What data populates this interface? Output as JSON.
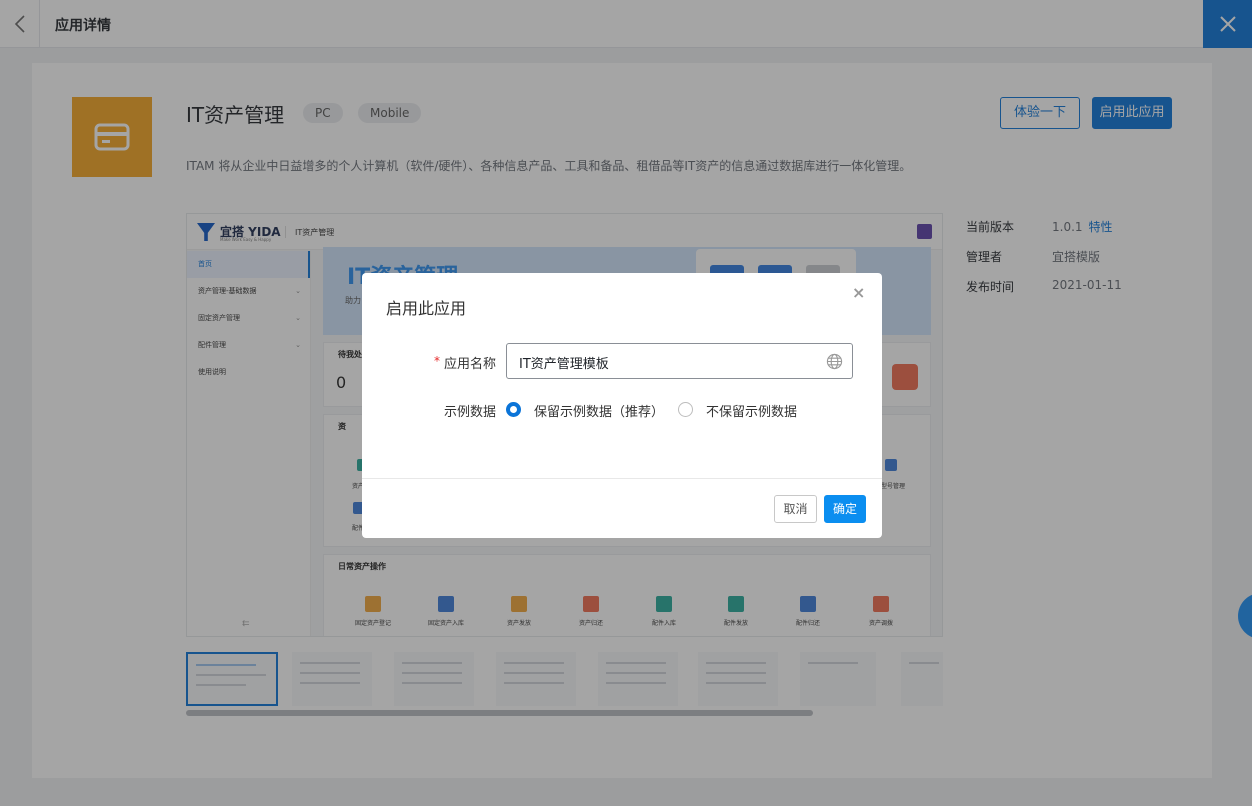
{
  "topbar": {
    "title": "应用详情"
  },
  "app": {
    "name": "IT资产管理",
    "tags": [
      "PC",
      "Mobile"
    ],
    "try_label": "体验一下",
    "enable_label": "启用此应用",
    "description": "ITAM 将从企业中日益增多的个人计算机（软件/硬件）、各种信息产品、工具和备品、租借品等IT资产的信息通过数据库进行一体化管理。"
  },
  "meta": {
    "version_label": "当前版本",
    "version_value": "1.0.1",
    "features_link": "特性",
    "admin_label": "管理者",
    "admin_value": "宜搭模版",
    "publish_label": "发布时间",
    "publish_value": "2021-01-11"
  },
  "preview": {
    "brand": "宜搭 YIDA",
    "brand_sub": "Make Work Easy & Happy",
    "app_title": "IT资产管理",
    "nav": [
      {
        "label": "首页",
        "active": true,
        "chevron": false
      },
      {
        "label": "资产管理-基础数据",
        "active": false,
        "chevron": true
      },
      {
        "label": "固定资产管理",
        "active": false,
        "chevron": true
      },
      {
        "label": "配件管理",
        "active": false,
        "chevron": true
      },
      {
        "label": "使用说明",
        "active": false,
        "chevron": false
      }
    ],
    "side_footer": "⇇",
    "banner_title": "IT资产管理",
    "banner_sub": "助力",
    "pending_title": "待我处理",
    "pending_count": "0",
    "section1_title": "资",
    "tile_labels": [
      "资产",
      "配件",
      "型号管理"
    ],
    "ops_title": "日常资产操作",
    "ops": [
      {
        "label": "固定资产登记",
        "color": "#f2a53a"
      },
      {
        "label": "固定资产入库",
        "color": "#3b7bd8"
      },
      {
        "label": "资产发放",
        "color": "#f2a53a"
      },
      {
        "label": "资产归还",
        "color": "#f06b4f"
      },
      {
        "label": "配件入库",
        "color": "#27a99a"
      },
      {
        "label": "配件发放",
        "color": "#27a99a"
      },
      {
        "label": "配件归还",
        "color": "#3b7bd8"
      },
      {
        "label": "资产调拨",
        "color": "#f06b4f"
      }
    ]
  },
  "dialog": {
    "title": "启用此应用",
    "name_label": "应用名称",
    "name_value": "IT资产管理模板",
    "sample_label": "示例数据",
    "option_keep": "保留示例数据（推荐）",
    "option_discard": "不保留示例数据",
    "cancel_label": "取消",
    "ok_label": "确定"
  },
  "colors": {
    "accent": "#0b74d8",
    "app_icon": "#f5a623"
  },
  "icons": [
    "chevron-left-icon",
    "close-icon",
    "card-icon",
    "globe-icon"
  ]
}
